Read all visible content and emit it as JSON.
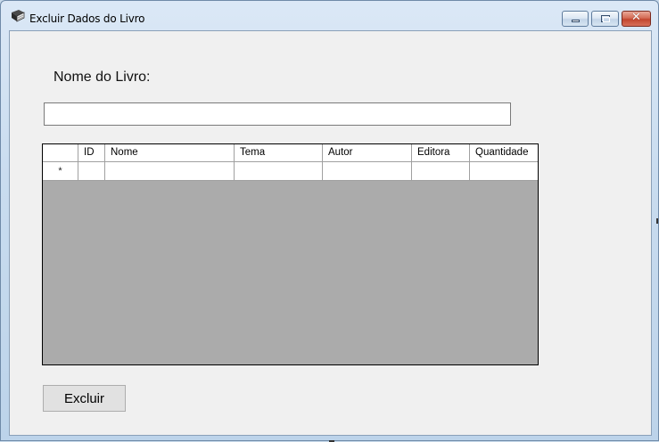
{
  "window": {
    "title": "Excluir Dados do Livro",
    "icon": "book-icon",
    "close_glyph": "✕"
  },
  "form": {
    "nome_label": "Nome do Livro:",
    "nome_value": "",
    "nome_placeholder": ""
  },
  "grid": {
    "columns": [
      "ID",
      "Nome",
      "Tema",
      "Autor",
      "Editora",
      "Quantidade"
    ],
    "new_row_marker": "*",
    "background_color": "#ababab"
  },
  "actions": {
    "excluir_label": "Excluir"
  },
  "colors": {
    "client_bg": "#f0f0f0",
    "close_button": "#c2462f"
  }
}
